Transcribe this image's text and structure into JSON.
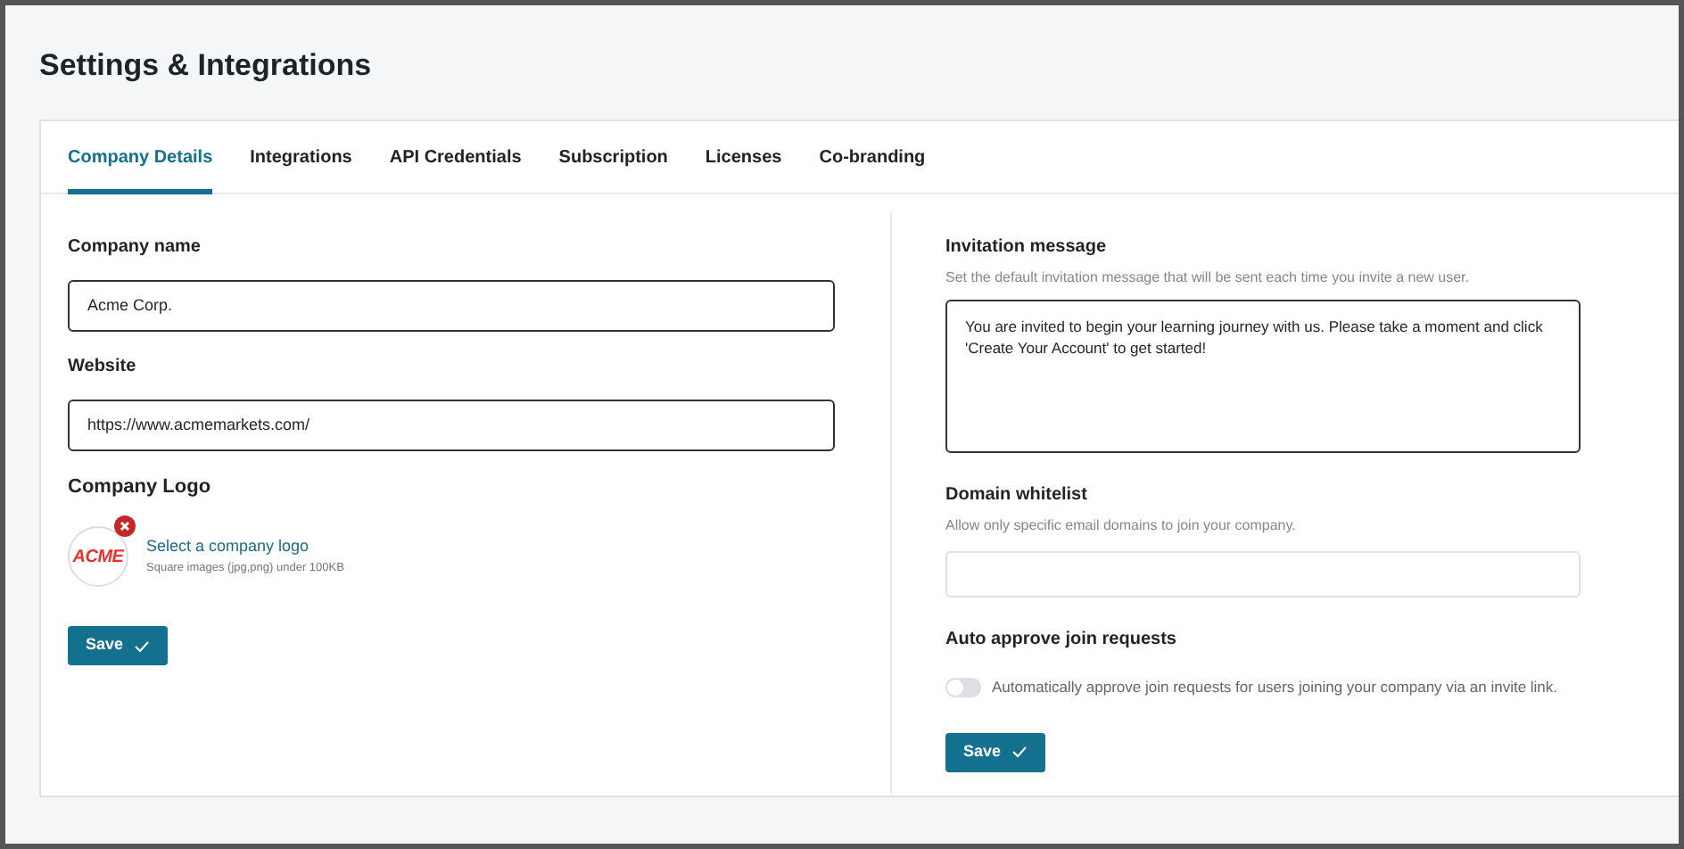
{
  "page": {
    "title": "Settings & Integrations"
  },
  "tabs": [
    {
      "label": "Company Details",
      "selected": true
    },
    {
      "label": "Integrations",
      "selected": false
    },
    {
      "label": "API Credentials",
      "selected": false
    },
    {
      "label": "Subscription",
      "selected": false
    },
    {
      "label": "Licenses",
      "selected": false
    },
    {
      "label": "Co-branding",
      "selected": false
    }
  ],
  "company_details": {
    "fields": [
      {
        "label": "Company name",
        "value": "Acme Corp."
      },
      {
        "label": "Website",
        "value": "https://www.acmemarkets.com/"
      }
    ],
    "logo": {
      "label": "Company Logo",
      "logo_text": "ACME",
      "link": "Select a company logo",
      "hint": "Square images (jpg,png) under 100KB"
    },
    "save_button": "Save"
  },
  "invitation": {
    "label": "Invitation message",
    "description": "Set the default invitation message that will be sent each time you invite a new user.",
    "value": "You are invited to begin your learning journey with us. Please take a moment and click 'Create Your Account' to get started!"
  },
  "domain_whitelist": {
    "label": "Domain whitelist",
    "description": "Allow only specific email domains to join your company."
  },
  "auto_approve": {
    "label": "Auto approve join requests",
    "toggle_label": "Automatically approve join requests for users joining your company via an invite link.",
    "on": false
  },
  "right_save_button": "Save"
}
